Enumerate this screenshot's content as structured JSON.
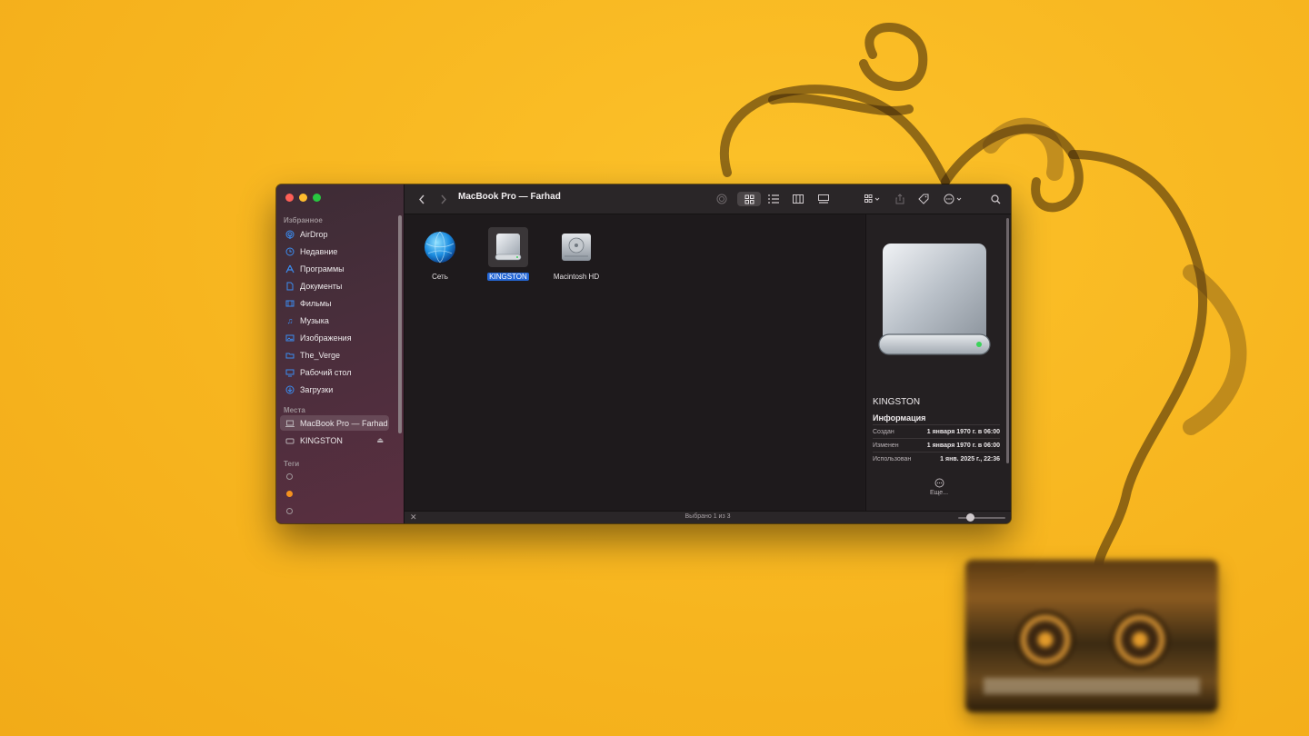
{
  "window": {
    "title": "MacBook Pro — Farhad"
  },
  "sidebar": {
    "favorites_header": "Избранное",
    "favorites": [
      {
        "label": "AirDrop",
        "icon": "airdrop-icon"
      },
      {
        "label": "Недавние",
        "icon": "clock-icon"
      },
      {
        "label": "Программы",
        "icon": "apps-icon"
      },
      {
        "label": "Документы",
        "icon": "document-icon"
      },
      {
        "label": "Фильмы",
        "icon": "film-icon"
      },
      {
        "label": "Музыка",
        "icon": "music-note-icon"
      },
      {
        "label": "Изображения",
        "icon": "photo-icon"
      },
      {
        "label": "The_Verge",
        "icon": "folder-icon"
      },
      {
        "label": "Рабочий стол",
        "icon": "desktop-icon"
      },
      {
        "label": "Загрузки",
        "icon": "download-icon"
      }
    ],
    "places_header": "Места",
    "places": [
      {
        "label": "MacBook Pro — Farhad",
        "icon": "laptop-icon",
        "selected": true
      },
      {
        "label": "KINGSTON",
        "icon": "external-drive-icon",
        "eject": true
      }
    ],
    "tags_header": "Теги",
    "tags": [
      {
        "color": "none"
      },
      {
        "color": "#f4911e"
      },
      {
        "color": "none"
      }
    ]
  },
  "items": [
    {
      "label": "Сеть",
      "icon": "network-globe-icon",
      "selected": false
    },
    {
      "label": "KINGSTON",
      "icon": "external-drive-icon",
      "selected": true
    },
    {
      "label": "Macintosh HD",
      "icon": "internal-drive-icon",
      "selected": false
    }
  ],
  "preview": {
    "name": "KINGSTON",
    "info_header": "Информация",
    "rows": [
      {
        "key": "Создан",
        "value": "1 января 1970 г. в 06:00"
      },
      {
        "key": "Изменен",
        "value": "1 января 1970 г. в 06:00"
      },
      {
        "key": "Использован",
        "value": "1 янв. 2025 г., 22:36"
      }
    ],
    "more_label": "Еще..."
  },
  "status": {
    "text": "Выбрано 1 из 3"
  },
  "colors": {
    "accent": "#2466d4",
    "selection_text_bg": "#2466d4"
  }
}
